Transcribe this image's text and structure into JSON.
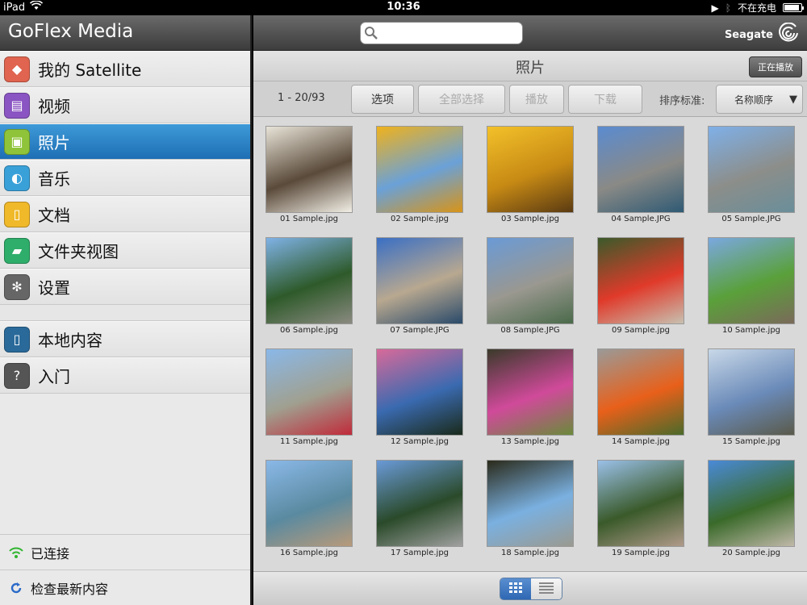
{
  "status": {
    "device": "iPad",
    "time": "10:36",
    "charging": "不在充电",
    "battery_level": 0.9
  },
  "sidebar": {
    "title": "GoFlex Media",
    "items": [
      {
        "label": "我的 Satellite",
        "icon": "satellite-icon",
        "color": "#e0644f"
      },
      {
        "label": "视频",
        "icon": "video-clapper-icon",
        "color": "#8a54c2"
      },
      {
        "label": "照片",
        "icon": "photo-icon",
        "color": "#8fc43a",
        "active": true
      },
      {
        "label": "音乐",
        "icon": "headphones-icon",
        "color": "#3aa1d8"
      },
      {
        "label": "文档",
        "icon": "document-icon",
        "color": "#f0b92a"
      },
      {
        "label": "文件夹视图",
        "icon": "folder-icon",
        "color": "#2eae6a"
      },
      {
        "label": "设置",
        "icon": "gear-icon",
        "color": "#666666"
      }
    ],
    "items2": [
      {
        "label": "本地内容",
        "icon": "tablet-icon",
        "color": "#2a6a9a"
      },
      {
        "label": "入门",
        "icon": "help-icon",
        "color": "#555555"
      }
    ],
    "connected": "已连接",
    "check_updates": "检查最新内容"
  },
  "topbar": {
    "search_placeholder": "",
    "brand": "Seagate"
  },
  "titlebar": {
    "title": "照片",
    "now_playing": "正在播放"
  },
  "toolbar": {
    "count": "1 - 20/93",
    "options": "选项",
    "select_all": "全部选择",
    "play": "播放",
    "download": "下载",
    "sort_label": "排序标准:",
    "sort_value": "名称顺序"
  },
  "photos": [
    {
      "caption": "01 Sample.jpg",
      "colors": [
        "#e8e4d8",
        "#5a4a3a",
        "#f2efe6"
      ]
    },
    {
      "caption": "02 Sample.jpg",
      "colors": [
        "#f0b21c",
        "#6aa1d8",
        "#d89418"
      ]
    },
    {
      "caption": "03 Sample.jpg",
      "colors": [
        "#f3c12a",
        "#c78a14",
        "#5a3a12"
      ]
    },
    {
      "caption": "04 Sample.JPG",
      "colors": [
        "#5a8bd0",
        "#8a8a86",
        "#2f5a74"
      ]
    },
    {
      "caption": "05 Sample.JPG",
      "colors": [
        "#7fb0e8",
        "#8c8e8a",
        "#6a8e9a"
      ]
    },
    {
      "caption": "06 Sample.jpg",
      "colors": [
        "#7fb2e6",
        "#2e5a2a",
        "#8a8a80"
      ]
    },
    {
      "caption": "07 Sample.JPG",
      "colors": [
        "#3a6fc4",
        "#b8a890",
        "#2a4a6a"
      ]
    },
    {
      "caption": "08 Sample.JPG",
      "colors": [
        "#6a9ad6",
        "#9a9890",
        "#4a6a4a"
      ]
    },
    {
      "caption": "09 Sample.jpg",
      "colors": [
        "#3a5a2a",
        "#e03a2a",
        "#c8c0b0"
      ]
    },
    {
      "caption": "10 Sample.jpg",
      "colors": [
        "#7aa8e0",
        "#5aa03a",
        "#7a6a5a"
      ]
    },
    {
      "caption": "11 Sample.jpg",
      "colors": [
        "#8ab8e8",
        "#a0a090",
        "#c02a3a"
      ]
    },
    {
      "caption": "12 Sample.jpg",
      "colors": [
        "#d86a9a",
        "#3a6ab0",
        "#1a2a1a"
      ]
    },
    {
      "caption": "13 Sample.jpg",
      "colors": [
        "#3a3a2a",
        "#d04a9a",
        "#6a8a3a"
      ]
    },
    {
      "caption": "14 Sample.jpg",
      "colors": [
        "#9a9a98",
        "#e8601a",
        "#4a6a2a"
      ]
    },
    {
      "caption": "15 Sample.jpg",
      "colors": [
        "#c8d8e8",
        "#6a8ab8",
        "#5a5a4a"
      ]
    },
    {
      "caption": "16 Sample.jpg",
      "colors": [
        "#8ab8e8",
        "#5a8aa0",
        "#b89a7a"
      ]
    },
    {
      "caption": "17 Sample.jpg",
      "colors": [
        "#6a9ad8",
        "#2a4a2a",
        "#a0a0a0"
      ]
    },
    {
      "caption": "18 Sample.jpg",
      "colors": [
        "#2a2a1a",
        "#7ab0e0",
        "#9a9a90"
      ]
    },
    {
      "caption": "19 Sample.jpg",
      "colors": [
        "#9ac0e8",
        "#3a5a2a",
        "#b09a8a"
      ]
    },
    {
      "caption": "20 Sample.jpg",
      "colors": [
        "#4a8ad8",
        "#3a6a2a",
        "#c0b8a8"
      ]
    }
  ],
  "view": {
    "grid_icon": "grid-view-icon",
    "list_icon": "list-view-icon",
    "selected": "grid"
  }
}
